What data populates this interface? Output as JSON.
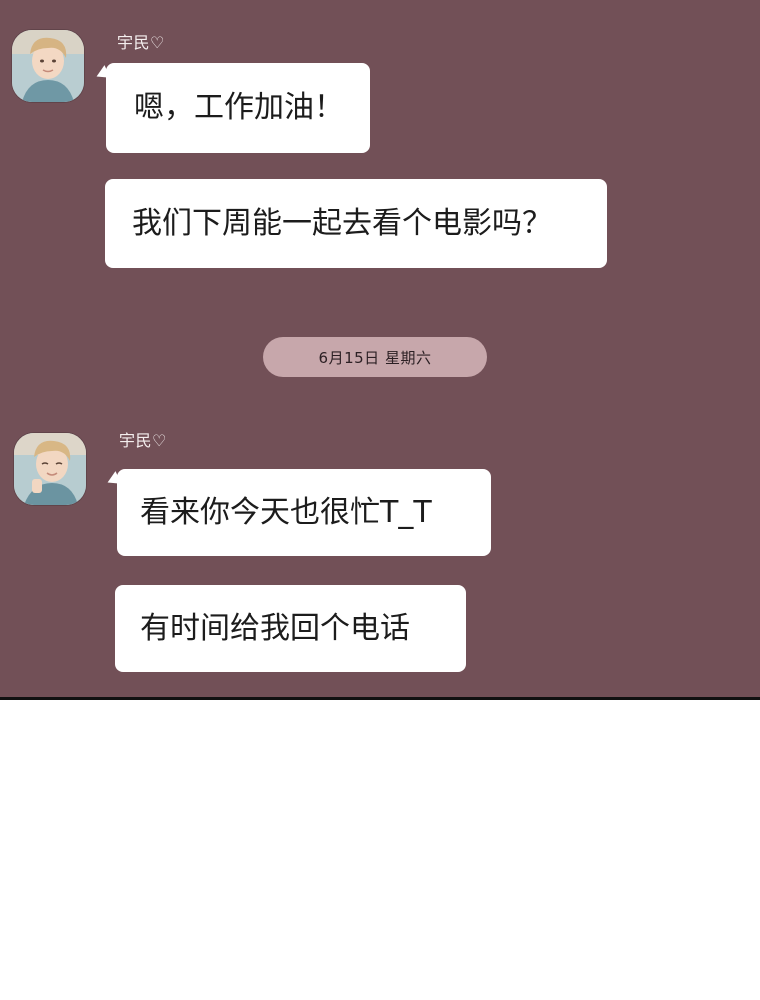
{
  "chat": {
    "date_separator": "6月15日 星期六",
    "groups": [
      {
        "sender": "宇民♡",
        "messages": [
          "嗯，工作加油！",
          "我们下周能一起去看个电影吗？"
        ]
      },
      {
        "sender": "宇民♡",
        "messages": [
          "看来你今天也很忙T_T",
          "有时间给我回个电话"
        ]
      }
    ]
  },
  "colors": {
    "chat_background": "#725057",
    "bubble": "#ffffff",
    "date_pill": "#c7a7ab"
  }
}
